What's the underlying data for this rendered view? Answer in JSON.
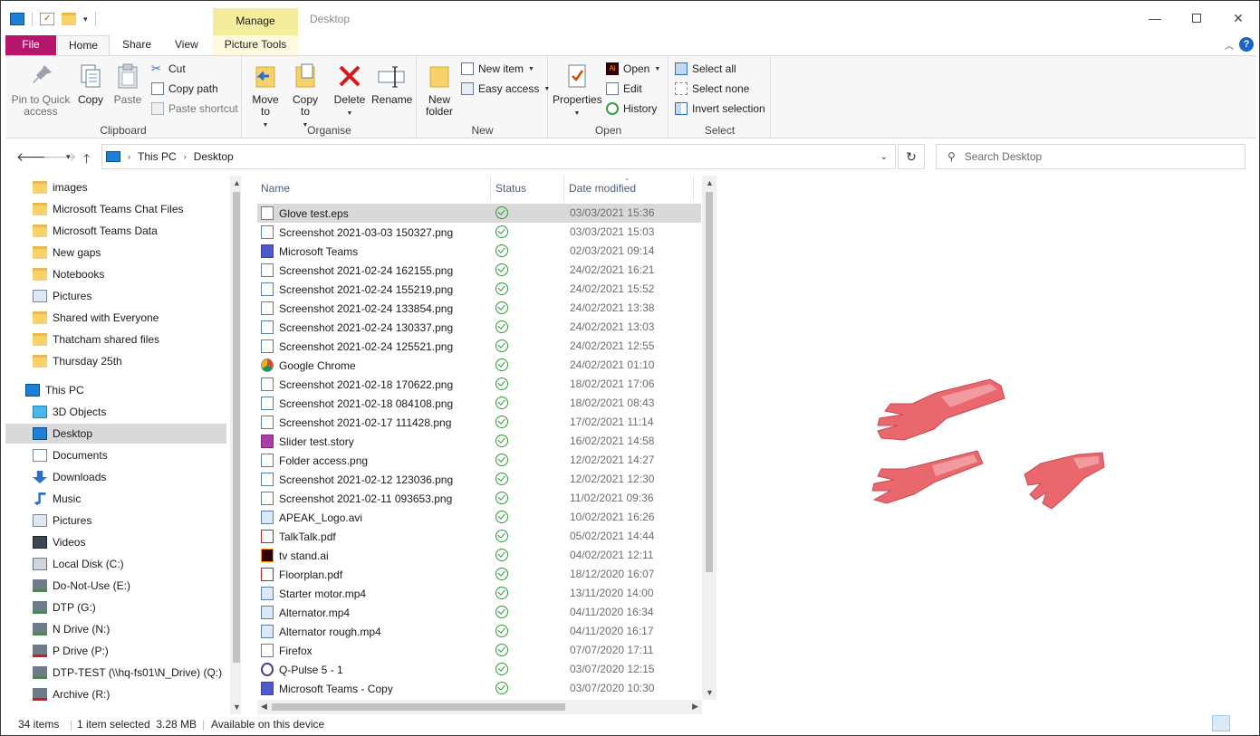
{
  "window": {
    "title": "Desktop",
    "contextual_tab_group": "Manage"
  },
  "ribbon_tabs": {
    "file": "File",
    "home": "Home",
    "share": "Share",
    "view": "View",
    "picture_tools": "Picture Tools"
  },
  "ribbon": {
    "clipboard": {
      "label": "Clipboard",
      "pin": "Pin to Quick access",
      "copy": "Copy",
      "paste": "Paste",
      "cut": "Cut",
      "copy_path": "Copy path",
      "paste_shortcut": "Paste shortcut"
    },
    "organise": {
      "label": "Organise",
      "move_to": "Move to",
      "copy_to": "Copy to",
      "delete": "Delete",
      "rename": "Rename"
    },
    "new": {
      "label": "New",
      "new_folder": "New folder",
      "new_item": "New item",
      "easy_access": "Easy access"
    },
    "open": {
      "label": "Open",
      "properties": "Properties",
      "open": "Open",
      "edit": "Edit",
      "history": "History"
    },
    "select": {
      "label": "Select",
      "select_all": "Select all",
      "select_none": "Select none",
      "invert_selection": "Invert selection"
    }
  },
  "address": {
    "segments": [
      "This PC",
      "Desktop"
    ],
    "search_placeholder": "Search Desktop"
  },
  "nav_pane": {
    "items": [
      {
        "label": "images",
        "icon": "folder-icon"
      },
      {
        "label": "Microsoft Teams Chat Files",
        "icon": "folder-icon"
      },
      {
        "label": "Microsoft Teams Data",
        "icon": "folder-icon"
      },
      {
        "label": "New gaps",
        "icon": "folder-icon"
      },
      {
        "label": "Notebooks",
        "icon": "folder-icon"
      },
      {
        "label": "Pictures",
        "icon": "pictures-icon"
      },
      {
        "label": "Shared with Everyone",
        "icon": "folder-icon"
      },
      {
        "label": "Thatcham shared files",
        "icon": "folder-icon"
      },
      {
        "label": "Thursday 25th",
        "icon": "folder-icon"
      },
      {
        "label": "This PC",
        "icon": "computer-icon"
      },
      {
        "label": "3D Objects",
        "icon": "3d-objects-icon"
      },
      {
        "label": "Desktop",
        "icon": "desktop-icon"
      },
      {
        "label": "Documents",
        "icon": "documents-icon"
      },
      {
        "label": "Downloads",
        "icon": "downloads-icon"
      },
      {
        "label": "Music",
        "icon": "music-icon"
      },
      {
        "label": "Pictures",
        "icon": "pictures-icon"
      },
      {
        "label": "Videos",
        "icon": "videos-icon"
      },
      {
        "label": "Local Disk (C:)",
        "icon": "drive-icon"
      },
      {
        "label": "Do-Not-Use (E:)",
        "icon": "network-drive-icon"
      },
      {
        "label": "DTP (G:)",
        "icon": "network-drive-icon"
      },
      {
        "label": "N Drive (N:)",
        "icon": "network-drive-icon"
      },
      {
        "label": "P Drive (P:)",
        "icon": "disconnected-drive-icon"
      },
      {
        "label": "DTP-TEST (\\\\hq-fs01\\N_Drive) (Q:)",
        "icon": "network-drive-icon"
      },
      {
        "label": "Archive (R:)",
        "icon": "disconnected-drive-icon"
      }
    ]
  },
  "file_list": {
    "columns": {
      "name": "Name",
      "status": "Status",
      "date_modified": "Date modified"
    },
    "rows": [
      {
        "name": "Glove test.eps",
        "date": "03/03/2021 15:36",
        "icon": "eps-file-icon"
      },
      {
        "name": "Screenshot 2021-03-03 150327.png",
        "date": "03/03/2021 15:03",
        "icon": "png-file-icon"
      },
      {
        "name": "Microsoft Teams",
        "date": "02/03/2021 09:14",
        "icon": "teams-icon"
      },
      {
        "name": "Screenshot 2021-02-24 162155.png",
        "date": "24/02/2021 16:21",
        "icon": "png-file-icon"
      },
      {
        "name": "Screenshot 2021-02-24 155219.png",
        "date": "24/02/2021 15:52",
        "icon": "png-file-icon"
      },
      {
        "name": "Screenshot 2021-02-24 133854.png",
        "date": "24/02/2021 13:38",
        "icon": "png-file-icon"
      },
      {
        "name": "Screenshot 2021-02-24 130337.png",
        "date": "24/02/2021 13:03",
        "icon": "png-file-icon"
      },
      {
        "name": "Screenshot 2021-02-24 125521.png",
        "date": "24/02/2021 12:55",
        "icon": "png-file-icon"
      },
      {
        "name": "Google Chrome",
        "date": "24/02/2021 01:10",
        "icon": "chrome-icon"
      },
      {
        "name": "Screenshot 2021-02-18 170622.png",
        "date": "18/02/2021 17:06",
        "icon": "png-file-icon"
      },
      {
        "name": "Screenshot 2021-02-18 084108.png",
        "date": "18/02/2021 08:43",
        "icon": "png-file-icon"
      },
      {
        "name": "Screenshot 2021-02-17 111428.png",
        "date": "17/02/2021 11:14",
        "icon": "png-file-icon"
      },
      {
        "name": "Slider test.story",
        "date": "16/02/2021 14:58",
        "icon": "storyline-icon"
      },
      {
        "name": "Folder access.png",
        "date": "12/02/2021 14:27",
        "icon": "png-file-icon"
      },
      {
        "name": "Screenshot 2021-02-12 123036.png",
        "date": "12/02/2021 12:30",
        "icon": "png-file-icon"
      },
      {
        "name": "Screenshot 2021-02-11 093653.png",
        "date": "11/02/2021 09:36",
        "icon": "png-file-icon"
      },
      {
        "name": "APEAK_Logo.avi",
        "date": "10/02/2021 16:26",
        "icon": "video-file-icon"
      },
      {
        "name": "TalkTalk.pdf",
        "date": "05/02/2021 14:44",
        "icon": "pdf-file-icon"
      },
      {
        "name": "tv stand.ai",
        "date": "04/02/2021 12:11",
        "icon": "illustrator-file-icon"
      },
      {
        "name": "Floorplan.pdf",
        "date": "18/12/2020 16:07",
        "icon": "pdf-file-icon"
      },
      {
        "name": "Starter motor.mp4",
        "date": "13/11/2020 14:00",
        "icon": "video-file-icon"
      },
      {
        "name": "Alternator.mp4",
        "date": "04/11/2020 16:34",
        "icon": "video-file-icon"
      },
      {
        "name": "Alternator rough.mp4",
        "date": "04/11/2020 16:17",
        "icon": "video-file-icon"
      },
      {
        "name": "Firefox",
        "date": "07/07/2020 17:11",
        "icon": "shortcut-icon"
      },
      {
        "name": "Q-Pulse 5 - 1",
        "date": "03/07/2020 12:15",
        "icon": "qpulse-icon"
      },
      {
        "name": "Microsoft Teams - Copy",
        "date": "03/07/2020 10:30",
        "icon": "teams-icon"
      }
    ]
  },
  "status_bar": {
    "item_count": "34 items",
    "selection": "1 item selected  3.28 MB",
    "availability": "Available on this device"
  },
  "colors": {
    "file_tab": "#b5166b",
    "manage_band": "#f4ee9c",
    "synced_green": "#2e9a3a",
    "glove": "#e8686e"
  }
}
